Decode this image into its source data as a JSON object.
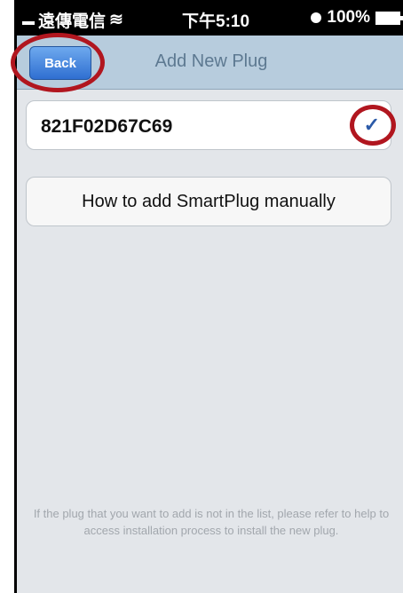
{
  "status_bar": {
    "carrier": "遠傳電信",
    "time": "下午5:10",
    "battery": "100%"
  },
  "nav": {
    "back_label": "Back",
    "title": "Add New Plug"
  },
  "plug_list": [
    {
      "id": "821F02D67C69",
      "selected": true
    }
  ],
  "how_to_button": "How to add SmartPlug manually",
  "footer_note": "If the plug that you want to add is not in the list, please refer to help to access installation process to install the new plug.",
  "colors": {
    "accent": "#2f6fd1",
    "highlight": "#b1161f"
  }
}
